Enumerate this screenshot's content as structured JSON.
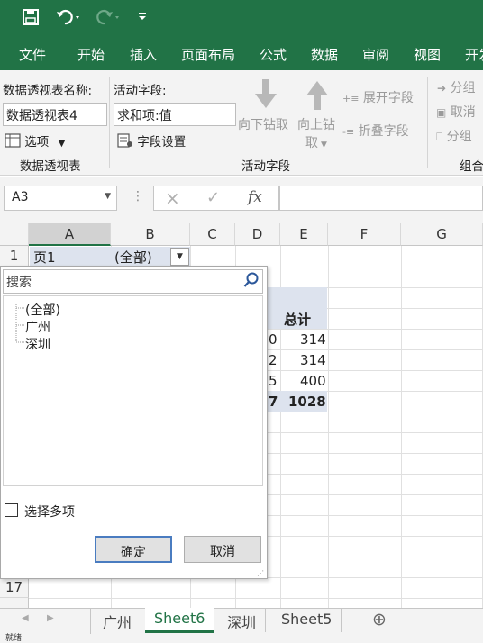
{
  "colors": {
    "brand": "#217346",
    "accent_text": "#217346"
  },
  "quick_access": {
    "save_icon": "save-icon",
    "undo_icon": "undo-icon",
    "redo_icon": "redo-icon",
    "customize_icon": "customize-icon"
  },
  "tabs": [
    "文件",
    "开始",
    "插入",
    "页面布局",
    "公式",
    "数据",
    "审阅",
    "视图",
    "开发"
  ],
  "ribbon": {
    "pivot_name_label": "数据透视表名称:",
    "pivot_name_value": "数据透视表4",
    "options_label": "选项",
    "group1_label": "数据透视表",
    "active_field_label": "活动字段:",
    "active_field_value": "求和项:值",
    "field_settings_label": "字段设置",
    "drill_down_label": "向下钻取",
    "drill_up_label_1": "向上钻",
    "drill_up_label_2": "取",
    "expand_field_label": "展开字段",
    "collapse_field_label": "折叠字段",
    "group2_label": "活动字段",
    "group_sel_label": "分组",
    "ungroup_label": "取消",
    "group_field_label": "分组",
    "group3_label": "组合"
  },
  "formula_bar": {
    "name_box": "A3",
    "cancel_icon": "×",
    "enter_icon": "✓",
    "fx_label": "fx",
    "formula_value": ""
  },
  "grid": {
    "columns": [
      "A",
      "B",
      "C",
      "D",
      "E",
      "F",
      "G"
    ],
    "row1": {
      "num": "1",
      "a": "页1",
      "b": "(全部)"
    },
    "row17": "17",
    "visible_fragment": {
      "total_header": "总计",
      "d_values": [
        "0",
        "2",
        "5",
        "7"
      ],
      "e_values": [
        "314",
        "314",
        "400",
        "1028"
      ]
    }
  },
  "filter_popup": {
    "search_placeholder": "搜索",
    "items": [
      "(全部)",
      "广州",
      "深圳"
    ],
    "multi_select_label": "选择多项",
    "ok_label": "确定",
    "cancel_label": "取消"
  },
  "sheet_tabs": [
    "广州",
    "Sheet6",
    "深圳",
    "Sheet5"
  ],
  "active_sheet": "Sheet6",
  "status_text": "就绪"
}
